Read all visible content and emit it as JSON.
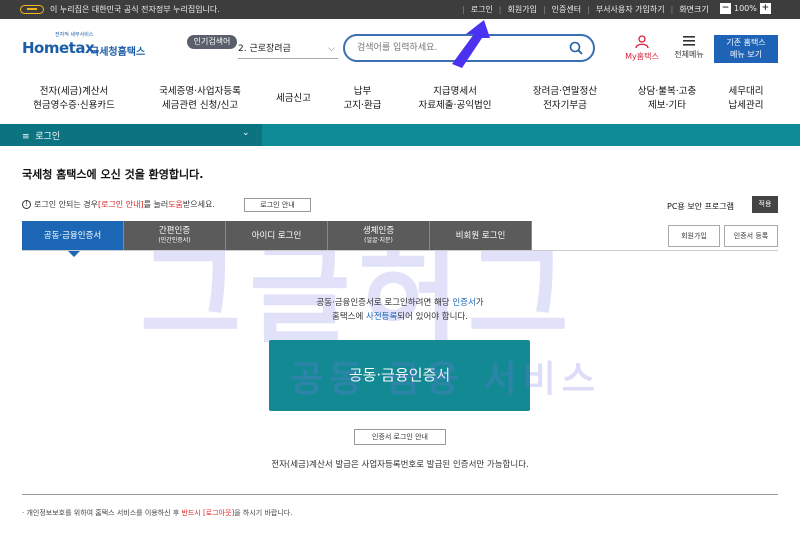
{
  "topbar": {
    "notice": "이 누리집은 대한민국 공식 전자정부 누리집입니다.",
    "links": [
      "로그인",
      "회원가입",
      "인증센터",
      "부서사용자 가입하기",
      "화면크기"
    ],
    "zoom_minus": "−",
    "zoom_value": "100%",
    "zoom_plus": "+"
  },
  "header": {
    "logo_small": "전자적 세무서비스",
    "logo_text": "Hometax.",
    "logo_kr": "국세청홈택스",
    "popular_label": "인기검색어",
    "popular_value": "2. 근로장려금",
    "search_placeholder": "검색어를 입력하세요.",
    "my_hometax": "My홈택스",
    "all_menu": "전체메뉴",
    "legacy_line1": "기존 홈택스",
    "legacy_line2": "메뉴 보기"
  },
  "gnb": [
    "전자(세금)계산서\n현금영수증·신용카드",
    "국세증명·사업자등록\n세금관련 신청/신고",
    "세금신고",
    "납부\n고지·환급",
    "지급명세서\n자료제출·공익법인",
    "장려금·연말정산\n전자기부금",
    "상담·불복·고충\n제보·기타",
    "세무대리\n납세관리"
  ],
  "breadcrumb": {
    "label": "로그인"
  },
  "main": {
    "welcome": "국세청 홈택스에 오신 것을 환영합니다.",
    "notice_pre": "로그인 안되는 경우 ",
    "notice_link": "[로그인 안내]",
    "notice_mid": "를 눌러 ",
    "notice_help": "도움",
    "notice_post": "받으세요.",
    "login_guide_btn": "로그인 안내",
    "pc_security": "PC용 보안 프로그램",
    "apply_btn": "적용",
    "tabs": [
      {
        "label": "공동·금융인증서",
        "sub": ""
      },
      {
        "label": "간편인증",
        "sub": "(민간인증서)"
      },
      {
        "label": "아이디 로그인",
        "sub": ""
      },
      {
        "label": "생체인증",
        "sub": "(얼굴·지문)"
      },
      {
        "label": "비회원 로그인",
        "sub": ""
      }
    ],
    "join_btn": "회원가입",
    "cert_register_btn": "인증서 등록",
    "desc_1a": "공동·금융인증서로 로그인하려면 해당 ",
    "desc_1b": "인증서",
    "desc_1c": "가",
    "desc_2a": "홈택스에 ",
    "desc_2b": "사전등록",
    "desc_2c": "되어 있어야 합니다.",
    "cert_button": "공동·금융인증서",
    "cert_guide": "인증서 로그인 안내",
    "cert_note": "전자(세금)계산서 발급은 사업자등록번호로 발급된 인증서만 가능합니다.",
    "foot_pre": "· 개인정보보호를 위하여 홈택스 서비스를 이용하신 후 ",
    "foot_red": "반드시 [로그아웃]",
    "foot_post": "을 하시기 바랍니다."
  },
  "watermark": {
    "big": "그글허그",
    "small": "공동 금융 서비스"
  },
  "colors": {
    "brand_blue": "#1c67b5",
    "teal": "#138a93",
    "arrow": "#4b32f0"
  }
}
